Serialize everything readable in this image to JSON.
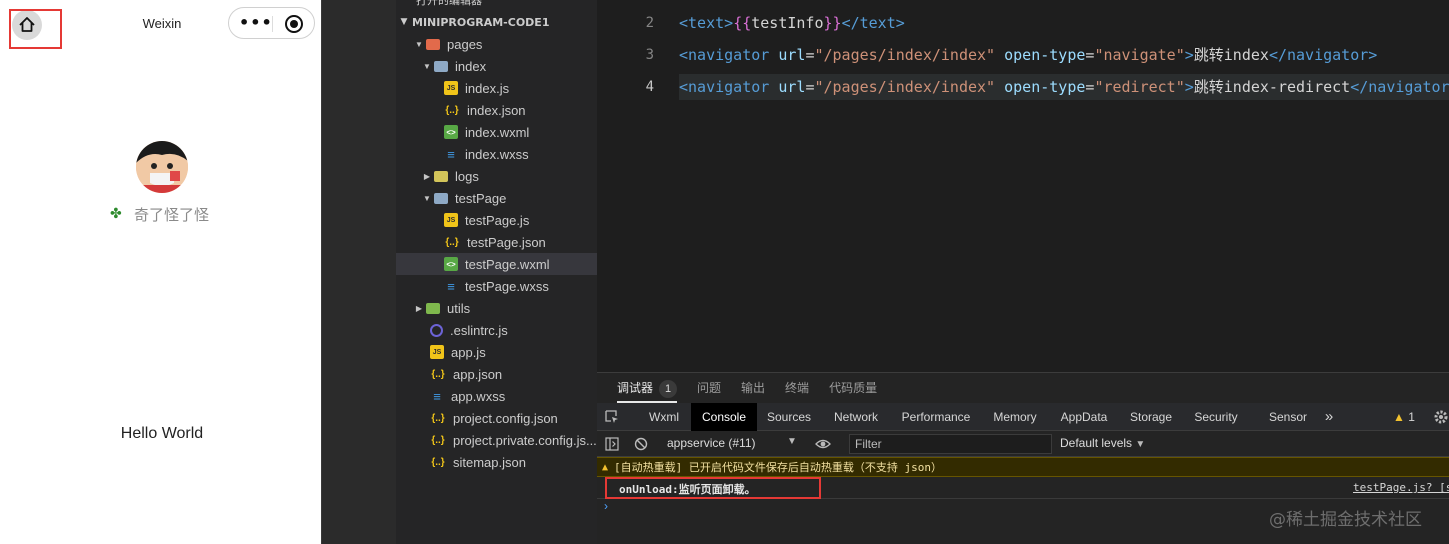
{
  "simulator": {
    "nav_title": "Weixin",
    "user_nickname": "奇了怪了怪",
    "hello_text": "Hello World"
  },
  "explorer": {
    "top_cut_label": "打开的编辑器",
    "project_name": "MINIPROGRAM-CODE1",
    "tree": [
      {
        "label": "pages",
        "icon": "folder-open-icon"
      },
      {
        "label": "index",
        "icon": "folder-open-icon"
      },
      {
        "label": "index.js",
        "icon": "js-file-icon"
      },
      {
        "label": "index.json",
        "icon": "json-file-icon"
      },
      {
        "label": "index.wxml",
        "icon": "wxml-file-icon"
      },
      {
        "label": "index.wxss",
        "icon": "wxss-file-icon"
      },
      {
        "label": "logs",
        "icon": "folder-icon"
      },
      {
        "label": "testPage",
        "icon": "folder-open-icon"
      },
      {
        "label": "testPage.js",
        "icon": "js-file-icon"
      },
      {
        "label": "testPage.json",
        "icon": "json-file-icon"
      },
      {
        "label": "testPage.wxml",
        "icon": "wxml-file-icon"
      },
      {
        "label": "testPage.wxss",
        "icon": "wxss-file-icon"
      },
      {
        "label": "utils",
        "icon": "folder-icon"
      },
      {
        "label": ".eslintrc.js",
        "icon": "eslint-icon"
      },
      {
        "label": "app.js",
        "icon": "js-file-icon"
      },
      {
        "label": "app.json",
        "icon": "json-file-icon"
      },
      {
        "label": "app.wxss",
        "icon": "wxss-file-icon"
      },
      {
        "label": "project.config.json",
        "icon": "json-file-icon"
      },
      {
        "label": "project.private.config.js...",
        "icon": "json-file-icon"
      },
      {
        "label": "sitemap.json",
        "icon": "json-file-icon"
      }
    ]
  },
  "editor": {
    "lines": [
      {
        "number": "2",
        "tag_open": "<text>",
        "expr_open": "{{",
        "expr_body": "testInfo",
        "expr_close": "}}",
        "tag_close": "</text>"
      },
      {
        "number": "3",
        "tag_open": "<navigator",
        "attr1": "url",
        "eq1": "=",
        "val1": "\"/pages/index/index\"",
        "attr2": "open-type",
        "eq2": "=",
        "val2": "\"navigate\"",
        "gt": ">",
        "text": "跳转index",
        "tag_close": "</navigator>"
      },
      {
        "number": "4",
        "tag_open": "<navigator",
        "attr1": "url",
        "eq1": "=",
        "val1": "\"/pages/index/index\"",
        "attr2": "open-type",
        "eq2": "=",
        "val2": "\"redirect\"",
        "gt": ">",
        "text": "跳转index-redirect",
        "tag_close": "</navigator>"
      }
    ]
  },
  "devtools": {
    "top_tabs": [
      {
        "label": "调试器",
        "badge": "1"
      },
      {
        "label": "问题"
      },
      {
        "label": "输出"
      },
      {
        "label": "终端"
      },
      {
        "label": "代码质量"
      }
    ],
    "panel_tabs": [
      "Wxml",
      "Console",
      "Sources",
      "Network",
      "Performance",
      "Memory",
      "AppData",
      "Storage",
      "Security",
      "Sensor"
    ],
    "active_panel": "Console",
    "more_tabs": "»",
    "warning_count": "1",
    "context_select": "appservice (#11)",
    "filter_placeholder": "Filter",
    "levels": "Default levels",
    "warning_message": "[自动热重载] 已开启代码文件保存后自动热重载（不支持 json）",
    "log_message": "onUnload:监听页面卸载。",
    "log_source": "testPage.js? [s",
    "prompt_symbol": "›",
    "watermark": "@稀土掘金技术社区"
  },
  "colors": {
    "highlight_box": "#e53935",
    "tag": "#569cd6",
    "attribute": "#9cdcfe",
    "string": "#ce9178",
    "mustache": "#da70d6"
  }
}
